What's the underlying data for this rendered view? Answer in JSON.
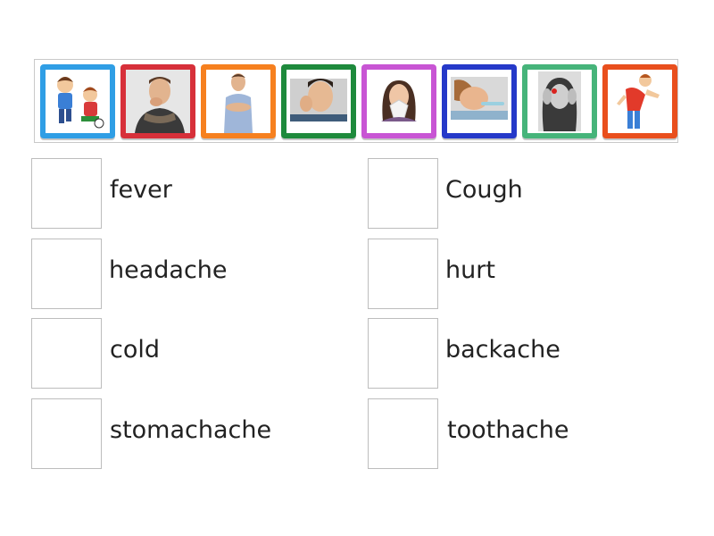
{
  "tiles": [
    {
      "name": "boys-hurt-knee",
      "color": "#2f9ee5"
    },
    {
      "name": "man-coughing",
      "color": "#d7303a"
    },
    {
      "name": "man-stomachache",
      "color": "#f6801f"
    },
    {
      "name": "man-toothache",
      "color": "#1e8a3c"
    },
    {
      "name": "woman-blowing-nose",
      "color": "#c855d4"
    },
    {
      "name": "child-with-thermometer",
      "color": "#2539c9"
    },
    {
      "name": "woman-headache",
      "color": "#46b47a"
    },
    {
      "name": "man-backache",
      "color": "#e94f1d"
    }
  ],
  "pairs_left": [
    {
      "label": "fever"
    },
    {
      "label": "headache"
    },
    {
      "label": "cold"
    },
    {
      "label": "stomachache"
    }
  ],
  "pairs_right": [
    {
      "label": "Cough"
    },
    {
      "label": "hurt"
    },
    {
      "label": "backache"
    },
    {
      "label": "toothache"
    }
  ]
}
